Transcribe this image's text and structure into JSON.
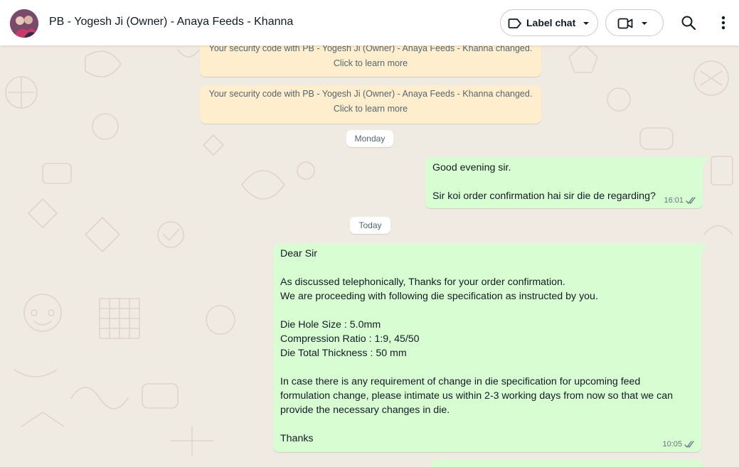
{
  "header": {
    "contact_name": "PB - Yogesh Ji (Owner) - Anaya Feeds - Khanna",
    "label_chat": "Label chat"
  },
  "system_messages": [
    {
      "line1": "Your security code with PB - Yogesh Ji (Owner) - Anaya Feeds - Khanna changed.",
      "line2": "Click to learn more"
    },
    {
      "line1": "Your security code with PB - Yogesh Ji (Owner) - Anaya Feeds - Khanna changed.",
      "line2": "Click to learn more"
    }
  ],
  "date_chips": {
    "monday": "Monday",
    "today": "Today"
  },
  "messages": [
    {
      "lines": [
        "Good evening sir.",
        "",
        "Sir koi order confirmation hai sir die de regarding?"
      ],
      "time": "16:01"
    },
    {
      "lines": [
        "Dear Sir",
        "",
        "As discussed telephonically, Thanks for your order confirmation.",
        "We are proceeding with following die specification as instructed by you.",
        "",
        "Die Hole Size : 5.0mm",
        "Compression Ratio : 1:9, 45/50",
        "Die Total Thickness : 50 mm",
        "",
        "In case there is any requirement of change in die specification for upcoming feed",
        "formulation change, please intimate us within 2-3 working days from now so that we can",
        "provide the necessary changes in die.",
        "",
        "Thanks"
      ],
      "time": "10:05"
    }
  ],
  "colors": {
    "outgoing_bubble": "#d9fdd3",
    "system_bubble": "#ffeecd",
    "chat_background": "#efeae2",
    "read_tick": "#667781"
  },
  "icons": [
    "label-icon",
    "chevron-down-icon",
    "video-icon",
    "search-icon",
    "menu-icon",
    "double-tick-icon"
  ]
}
